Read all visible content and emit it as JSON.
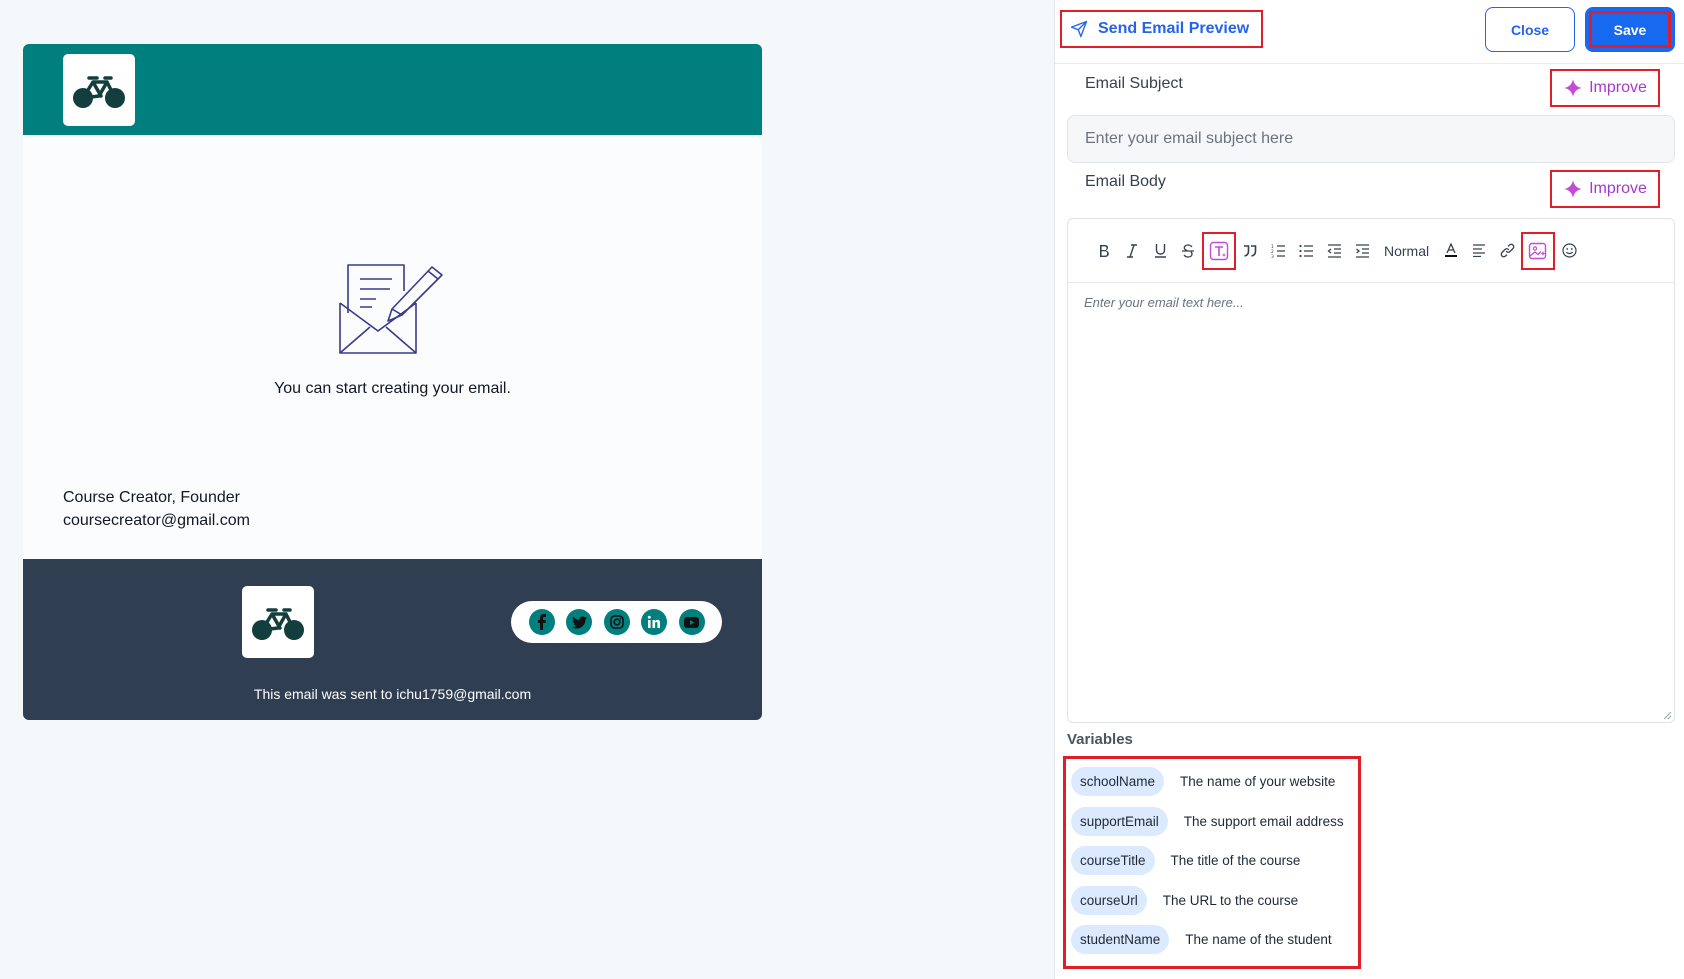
{
  "preview": {
    "start_text": "You can start creating your email.",
    "signature_line1": "Course Creator, Founder",
    "signature_line2": "coursecreator@gmail.com",
    "footer_note": "This email was sent to ichu1759@gmail.com",
    "header_color": "#007f7f",
    "footer_color": "#2f3e50",
    "social_icons": [
      "facebook-icon",
      "twitter-icon",
      "instagram-icon",
      "linkedin-icon",
      "youtube-icon"
    ]
  },
  "panel": {
    "send_preview_label": "Send Email Preview",
    "close_label": "Close",
    "save_label": "Save",
    "subject_label": "Email Subject",
    "subject_placeholder": "Enter your email subject here",
    "subject_value": "",
    "body_label": "Email Body",
    "improve_label": "Improve",
    "toolbar_format": "Normal",
    "editor_placeholder": "Enter your email text here...",
    "variables_title": "Variables",
    "variables": [
      {
        "name": "schoolName",
        "desc": "The name of your website"
      },
      {
        "name": "supportEmail",
        "desc": "The support email address"
      },
      {
        "name": "courseTitle",
        "desc": "The title of the course"
      },
      {
        "name": "courseUrl",
        "desc": "The URL to the course"
      },
      {
        "name": "studentName",
        "desc": "The name of the student"
      }
    ],
    "accent_color": "#2563eb",
    "highlight_color": "#e11d2a"
  }
}
